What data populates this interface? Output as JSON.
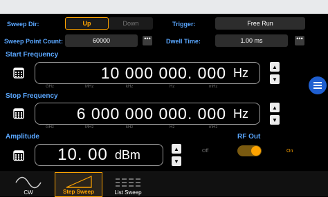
{
  "sweep": {
    "dir_label": "Sweep Dir:",
    "dir_up": "Up",
    "dir_down": "Down",
    "trigger_label": "Trigger:",
    "trigger_value": "Free Run",
    "point_count_label": "Sweep Point Count:",
    "point_count_value": "60000",
    "dwell_label": "Dwell Time:",
    "dwell_value": "1.00 ms",
    "more": "•••"
  },
  "start": {
    "label": "Start Frequency",
    "value": "10 000 000. 000",
    "unit": "Hz",
    "scale": [
      "GHz",
      "MHz",
      "kHz",
      "Hz",
      "mHz"
    ]
  },
  "stop": {
    "label": "Stop Frequency",
    "value": "6 000 000 000. 000",
    "unit": "Hz",
    "scale": [
      "GHz",
      "MHz",
      "kHz",
      "Hz",
      "mHz"
    ]
  },
  "amplitude": {
    "label": "Amplitude",
    "value": "10. 00",
    "unit": "dBm"
  },
  "rf_out": {
    "label": "RF Out",
    "off": "Off",
    "on": "On",
    "state": "on"
  },
  "tabs": [
    {
      "label": "CW",
      "icon": "sine-wave-icon",
      "active": false
    },
    {
      "label": "Step Sweep",
      "icon": "step-sweep-icon",
      "active": true
    },
    {
      "label": "List Sweep",
      "icon": "list-sweep-icon",
      "active": false
    }
  ],
  "colors": {
    "accent": "#ffa400",
    "label_blue": "#5aa7ff",
    "side_button": "#1f5fd1"
  }
}
